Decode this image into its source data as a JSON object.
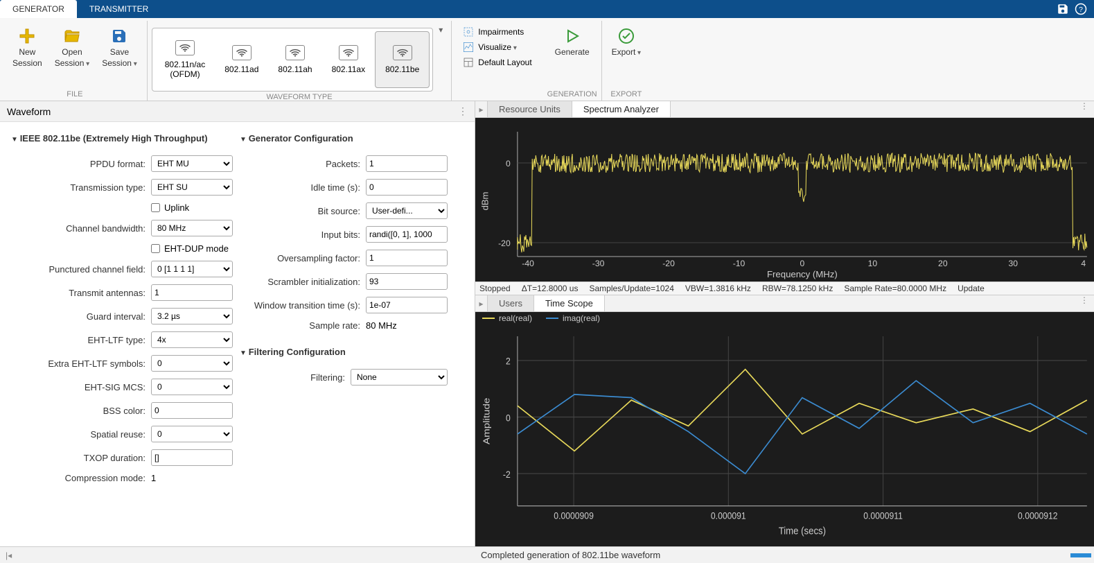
{
  "tabs": {
    "generator": "GENERATOR",
    "transmitter": "TRANSMITTER"
  },
  "ribbon": {
    "file": {
      "label": "FILE",
      "new": "New\nSession",
      "open": "Open\nSession",
      "save": "Save\nSession"
    },
    "waveform": {
      "label": "WAVEFORM TYPE",
      "items": [
        "802.11n/ac\n(OFDM)",
        "802.11ad",
        "802.11ah",
        "802.11ax",
        "802.11be"
      ]
    },
    "view": {
      "impairments": "Impairments",
      "visualize": "Visualize",
      "default_layout": "Default Layout"
    },
    "generation": {
      "label": "GENERATION",
      "generate": "Generate"
    },
    "export": {
      "label": "EXPORT",
      "export": "Export"
    }
  },
  "left": {
    "title": "Waveform",
    "sec1": "IEEE 802.11be (Extremely High Throughput)",
    "sec2": "Generator Configuration",
    "sec3": "Filtering Configuration",
    "ppdu_format": {
      "label": "PPDU format:",
      "value": "EHT MU"
    },
    "tx_type": {
      "label": "Transmission type:",
      "value": "EHT SU"
    },
    "uplink": {
      "label": "Uplink"
    },
    "bw": {
      "label": "Channel bandwidth:",
      "value": "80 MHz"
    },
    "eht_dup": {
      "label": "EHT-DUP mode"
    },
    "punctured": {
      "label": "Punctured channel field:",
      "value": "0 [1 1 1 1]"
    },
    "tx_ant": {
      "label": "Transmit antennas:",
      "value": "1"
    },
    "gi": {
      "label": "Guard interval:",
      "value": "3.2 µs"
    },
    "ltf": {
      "label": "EHT-LTF type:",
      "value": "4x"
    },
    "extra_ltf": {
      "label": "Extra EHT-LTF symbols:",
      "value": "0"
    },
    "sig_mcs": {
      "label": "EHT-SIG MCS:",
      "value": "0"
    },
    "bss": {
      "label": "BSS color:",
      "value": "0"
    },
    "sr": {
      "label": "Spatial reuse:",
      "value": "0"
    },
    "txop": {
      "label": "TXOP duration:",
      "value": "[]"
    },
    "cmp": {
      "label": "Compression mode:",
      "value": "1"
    },
    "packets": {
      "label": "Packets:",
      "value": "1"
    },
    "idle": {
      "label": "Idle time (s):",
      "value": "0"
    },
    "bitsource": {
      "label": "Bit source:",
      "value": "User-defi..."
    },
    "inputbits": {
      "label": "Input bits:",
      "value": "randi([0, 1], 1000"
    },
    "os": {
      "label": "Oversampling factor:",
      "value": "1"
    },
    "scrambler": {
      "label": "Scrambler initialization:",
      "value": "93"
    },
    "wtt": {
      "label": "Window transition time (s):",
      "value": "1e-07"
    },
    "srate": {
      "label": "Sample rate:",
      "value": "80 MHz"
    },
    "filtering": {
      "label": "Filtering:",
      "value": "None"
    }
  },
  "right": {
    "tab_ru": "Resource Units",
    "tab_sa": "Spectrum Analyzer",
    "tab_users": "Users",
    "tab_ts": "Time Scope",
    "status": {
      "state": "Stopped",
      "dt": "ΔT=12.8000 us",
      "spu": "Samples/Update=1024",
      "vbw": "VBW=1.3816 kHz",
      "rbw": "RBW=78.1250 kHz",
      "sr": "Sample Rate=80.0000 MHz",
      "upd": "Update"
    },
    "spectrum": {
      "ylabel": "dBm",
      "xlabel": "Frequency (MHz)",
      "yticks": [
        "0",
        "-20"
      ],
      "xticks": [
        "-40",
        "-30",
        "-20",
        "-10",
        "0",
        "10",
        "20",
        "30",
        "4"
      ]
    },
    "time": {
      "ylabel": "Amplitude",
      "xlabel": "Time (secs)",
      "yticks": [
        "2",
        "0",
        "-2"
      ],
      "xticks": [
        "0.0000909",
        "0.000091",
        "0.0000911",
        "0.0000912"
      ],
      "legend_real": "real(real)",
      "legend_imag": "imag(real)"
    }
  },
  "footer": {
    "status": "Completed generation of 802.11be waveform"
  },
  "chart_data": [
    {
      "type": "line",
      "title": "Spectrum Analyzer",
      "xlabel": "Frequency (MHz)",
      "ylabel": "dBm",
      "xlim": [
        -40,
        40
      ],
      "ylim": [
        -25,
        5
      ],
      "description": "Dense noisy spectrum trace near 0 dBm across -40..40 MHz with dip around 0 MHz and rolloff at band edges",
      "series": [
        {
          "name": "spectrum",
          "color": "#e8d95a"
        }
      ]
    },
    {
      "type": "line",
      "title": "Time Scope",
      "xlabel": "Time (secs)",
      "ylabel": "Amplitude",
      "xlim": [
        9.085e-05,
        9.125e-05
      ],
      "ylim": [
        -2.5,
        2.5
      ],
      "series": [
        {
          "name": "real(real)",
          "color": "#e8d95a",
          "x_us": [
            90.85,
            90.89,
            90.93,
            90.97,
            91.01,
            91.05,
            91.09,
            91.13,
            91.17,
            91.21,
            91.25
          ],
          "y": [
            0.4,
            -1.2,
            0.6,
            -0.3,
            1.7,
            -0.6,
            0.5,
            -0.2,
            0.3,
            -0.5,
            0.6
          ]
        },
        {
          "name": "imag(real)",
          "color": "#3b8bd0",
          "x_us": [
            90.85,
            90.89,
            90.93,
            90.97,
            91.01,
            91.05,
            91.09,
            91.13,
            91.17,
            91.21,
            91.25
          ],
          "y": [
            -0.6,
            0.8,
            0.7,
            -0.5,
            -2.0,
            0.7,
            -0.4,
            1.3,
            -0.2,
            0.5,
            -0.6
          ]
        }
      ]
    }
  ]
}
